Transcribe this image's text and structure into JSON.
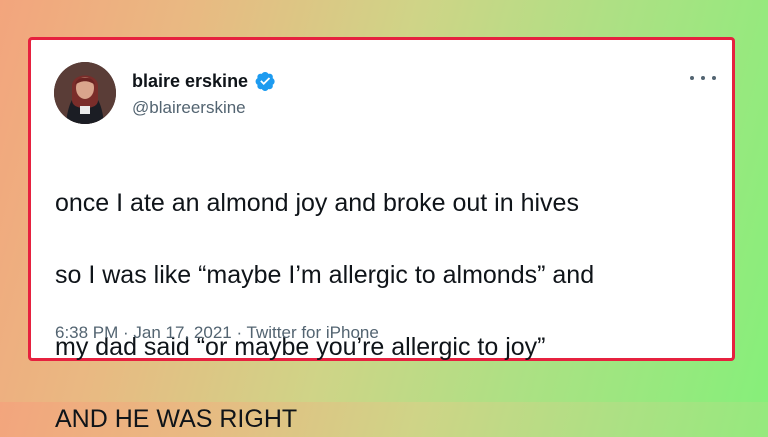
{
  "tweet": {
    "display_name": "blaire erskine",
    "handle": "@blaireerskine",
    "verified": true,
    "text_lines": [
      "once I ate an almond joy and broke out in hives",
      "so I was like “maybe I’m allergic to almonds” and",
      "my dad said “or maybe you’re allergic to joy”",
      "AND HE WAS RIGHT"
    ],
    "time": "6:38 PM",
    "separator": " · ",
    "date": "Jan 17, 2021",
    "source": "Twitter for iPhone",
    "icons": {
      "verified": "verified-badge-icon",
      "more": "more-options-icon",
      "avatar": "profile-avatar"
    }
  },
  "colors": {
    "border": "#e6213f",
    "verified": "#1d9bf0",
    "text": "#0f1419",
    "muted": "#536471",
    "background_left": "#f3a57d",
    "background_right": "#86ef7a"
  }
}
